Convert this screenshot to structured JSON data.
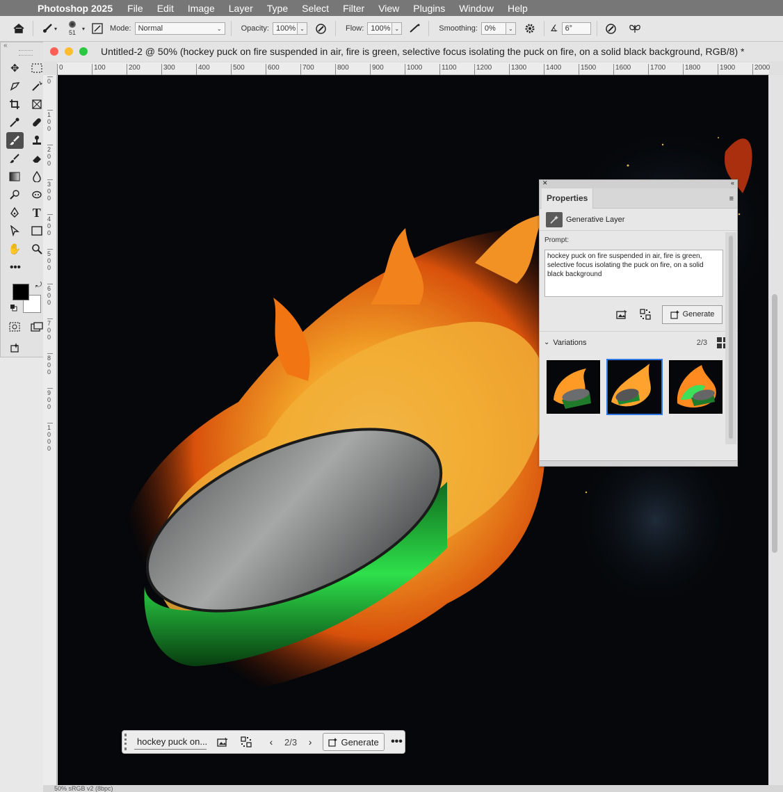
{
  "menubar": {
    "app_name": "Photoshop 2025",
    "items": [
      "File",
      "Edit",
      "Image",
      "Layer",
      "Type",
      "Select",
      "Filter",
      "View",
      "Plugins",
      "Window",
      "Help"
    ]
  },
  "options": {
    "brush_size": "51",
    "mode_label": "Mode:",
    "mode_value": "Normal",
    "opacity_label": "Opacity:",
    "opacity_value": "100%",
    "flow_label": "Flow:",
    "flow_value": "100%",
    "smoothing_label": "Smoothing:",
    "smoothing_value": "0%",
    "angle_value": "6°"
  },
  "document": {
    "title": "Untitled-2 @ 50% (hockey puck on fire suspended in air, fire is green, selective focus isolating the puck on fire, on a solid black background, RGB/8) *",
    "ruler_h": [
      "0",
      "100",
      "200",
      "300",
      "400",
      "500",
      "600",
      "700",
      "800",
      "900",
      "1000",
      "1100",
      "1200",
      "1300",
      "1400",
      "1500",
      "1600",
      "1700",
      "1800",
      "1900",
      "2000"
    ],
    "ruler_v": [
      "0",
      "100",
      "200",
      "300",
      "400",
      "500",
      "600",
      "700",
      "800",
      "900",
      "1000"
    ],
    "status": "50%          sRGB v2 (8bpc)"
  },
  "properties": {
    "tab_label": "Properties",
    "layer_type": "Generative Layer",
    "prompt_label": "Prompt:",
    "prompt_text": "hockey puck on fire suspended in air, fire is green, selective focus isolating the puck on fire, on a solid black background",
    "generate_label": "Generate",
    "variations_label": "Variations",
    "variations_count": "2/3"
  },
  "contextual_bar": {
    "prompt_short": "hockey puck on...",
    "count": "2/3",
    "generate_label": "Generate",
    "more_label": "•••"
  },
  "colors": {
    "accent": "#2f78e4",
    "fg_color": "#000000",
    "bg_color": "#ffffff"
  }
}
